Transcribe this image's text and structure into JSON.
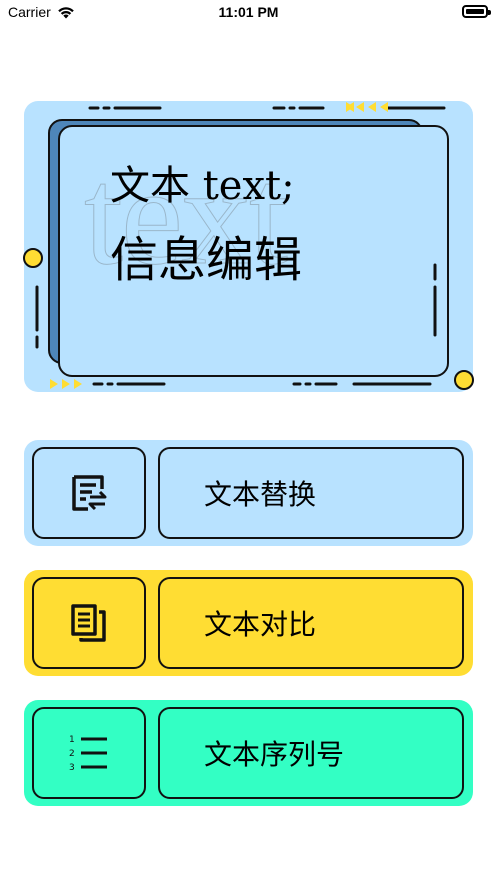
{
  "status_bar": {
    "carrier": "Carrier",
    "time": "11:01 PM"
  },
  "hero": {
    "watermark": "text",
    "line1": "文本 text;",
    "line2": "信息编辑"
  },
  "menu": [
    {
      "label": "文本替换",
      "icon": "text-replace-icon",
      "color": "#b8e2ff"
    },
    {
      "label": "文本对比",
      "icon": "text-compare-icon",
      "color": "#ffdd33"
    },
    {
      "label": "文本序列号",
      "icon": "numbered-list-icon",
      "color": "#33ffc4"
    }
  ],
  "colors": {
    "accent_yellow": "#ffdd33",
    "hero_blue": "#b8e2ff",
    "hero_dark_blue": "#4e86b9",
    "green": "#33ffc4"
  },
  "list_icon_numbers": [
    "1",
    "2",
    "3"
  ]
}
